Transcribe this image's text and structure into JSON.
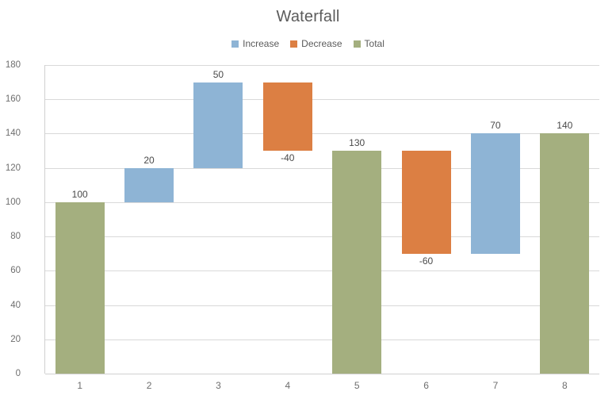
{
  "chart_data": {
    "type": "bar",
    "subtype": "waterfall",
    "title": "Waterfall",
    "xlabel": "",
    "ylabel": "",
    "ylim": [
      0,
      180
    ],
    "ytick_step": 20,
    "yticks": [
      0,
      20,
      40,
      60,
      80,
      100,
      120,
      140,
      160,
      180
    ],
    "categories": [
      "1",
      "2",
      "3",
      "4",
      "5",
      "6",
      "7",
      "8"
    ],
    "grid": true,
    "legend_position": "top",
    "legend": [
      {
        "label": "Increase",
        "color": "#8EB4D5"
      },
      {
        "label": "Decrease",
        "color": "#DC7F43"
      },
      {
        "label": "Total",
        "color": "#A4AF7F"
      }
    ],
    "values": [
      100,
      20,
      50,
      -40,
      130,
      -60,
      70,
      140
    ],
    "data_labels": [
      "100",
      "20",
      "50",
      "-40",
      "130",
      "-60",
      "70",
      "140"
    ],
    "bars": [
      {
        "category": "1",
        "label": "100",
        "value": 100,
        "base": 0,
        "top": 100,
        "type": "Total",
        "color": "#A4AF7F",
        "label_position": "above"
      },
      {
        "category": "2",
        "label": "20",
        "value": 20,
        "base": 100,
        "top": 120,
        "type": "Increase",
        "color": "#8EB4D5",
        "label_position": "above"
      },
      {
        "category": "3",
        "label": "50",
        "value": 50,
        "base": 120,
        "top": 170,
        "type": "Increase",
        "color": "#8EB4D5",
        "label_position": "above"
      },
      {
        "category": "4",
        "label": "-40",
        "value": -40,
        "base": 170,
        "top": 130,
        "type": "Decrease",
        "color": "#DC7F43",
        "label_position": "below"
      },
      {
        "category": "5",
        "label": "130",
        "value": 130,
        "base": 0,
        "top": 130,
        "type": "Total",
        "color": "#A4AF7F",
        "label_position": "above"
      },
      {
        "category": "6",
        "label": "-60",
        "value": -60,
        "base": 130,
        "top": 70,
        "type": "Decrease",
        "color": "#DC7F43",
        "label_position": "below"
      },
      {
        "category": "7",
        "label": "70",
        "value": 70,
        "base": 70,
        "top": 140,
        "type": "Increase",
        "color": "#8EB4D5",
        "label_position": "above"
      },
      {
        "category": "8",
        "label": "140",
        "value": 140,
        "base": 0,
        "top": 140,
        "type": "Total",
        "color": "#A4AF7F",
        "label_position": "above"
      }
    ],
    "colors": {
      "increase": "#8EB4D5",
      "decrease": "#DC7F43",
      "total": "#A4AF7F",
      "gridline": "#d9d9d9",
      "axis": "#d0d0d0",
      "text": "#595959",
      "background": "#ffffff"
    }
  }
}
